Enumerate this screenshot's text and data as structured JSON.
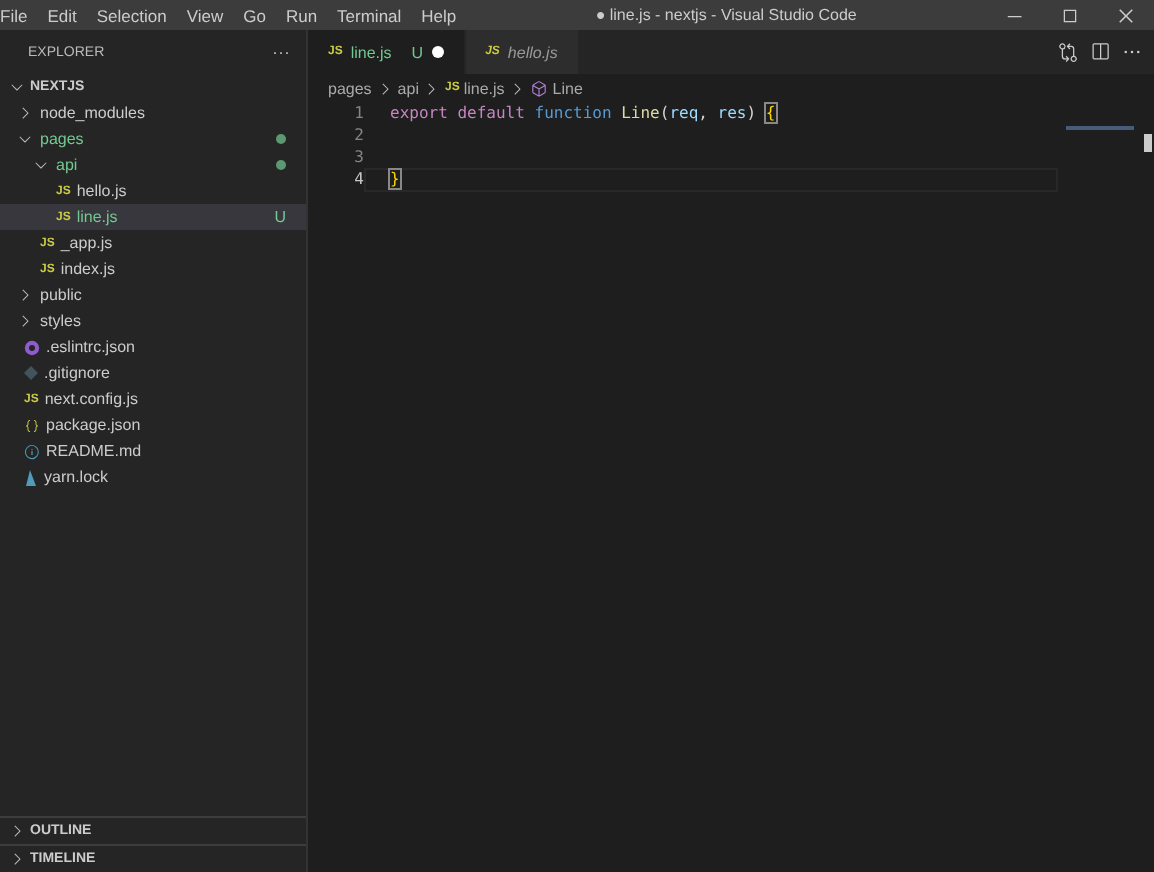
{
  "menu": [
    "File",
    "Edit",
    "Selection",
    "View",
    "Go",
    "Run",
    "Terminal",
    "Help"
  ],
  "window": {
    "title": "● line.js - nextjs - Visual Studio Code"
  },
  "explorer": {
    "title": "EXPLORER",
    "more": "···",
    "root": {
      "label": "NEXTJS",
      "expanded": true
    },
    "tree": [
      {
        "label": "node_modules",
        "kind": "folder",
        "expanded": false,
        "untracked": false,
        "selected": false
      },
      {
        "label": "pages",
        "kind": "folder",
        "expanded": true,
        "untracked": true,
        "dot": true,
        "selected": false,
        "children": [
          {
            "label": "api",
            "kind": "folder",
            "expanded": true,
            "untracked": true,
            "dot": true,
            "selected": false,
            "children": [
              {
                "label": "hello.js",
                "kind": "js",
                "icon_text": "JS",
                "untracked": false,
                "selected": false
              },
              {
                "label": "line.js",
                "kind": "js",
                "icon_text": "JS",
                "untracked": true,
                "badge": "U",
                "selected": true
              }
            ]
          },
          {
            "label": "_app.js",
            "kind": "js",
            "icon_text": "JS",
            "untracked": false,
            "selected": false
          },
          {
            "label": "index.js",
            "kind": "js",
            "icon_text": "JS",
            "untracked": false,
            "selected": false
          }
        ]
      },
      {
        "label": "public",
        "kind": "folder",
        "expanded": false,
        "untracked": false,
        "selected": false
      },
      {
        "label": "styles",
        "kind": "folder",
        "expanded": false,
        "untracked": false,
        "selected": false
      },
      {
        "label": ".eslintrc.json",
        "kind": "eslint",
        "untracked": false,
        "selected": false
      },
      {
        "label": ".gitignore",
        "kind": "git",
        "untracked": false,
        "selected": false
      },
      {
        "label": "next.config.js",
        "kind": "js",
        "icon_text": "JS",
        "untracked": false,
        "selected": false
      },
      {
        "label": "package.json",
        "kind": "json",
        "untracked": false,
        "selected": false
      },
      {
        "label": "README.md",
        "kind": "info",
        "untracked": false,
        "selected": false
      },
      {
        "label": "yarn.lock",
        "kind": "yarn",
        "untracked": false,
        "selected": false
      }
    ]
  },
  "panels": [
    {
      "label": "OUTLINE",
      "expanded": false
    },
    {
      "label": "TIMELINE",
      "expanded": false
    }
  ],
  "tabs": [
    {
      "label": "line.js",
      "icon_text": "JS",
      "badge": "U",
      "modified": true,
      "preview": false,
      "selected": true
    },
    {
      "label": "hello.js",
      "icon_text": "JS",
      "modified": false,
      "preview": true,
      "selected": false
    }
  ],
  "breadcrumbs": [
    {
      "label": "pages"
    },
    {
      "label": "api"
    },
    {
      "label": "line.js",
      "icon_text": "JS"
    },
    {
      "label": "Line",
      "kind": "function"
    }
  ],
  "code": [
    {
      "number": "1",
      "current": false,
      "tokens": [
        {
          "text": "export ",
          "kind": "keyword"
        },
        {
          "text": "default ",
          "kind": "keyword"
        },
        {
          "text": "function ",
          "kind": "storage"
        },
        {
          "text": "Line",
          "kind": "function"
        },
        {
          "text": "(",
          "kind": "punct"
        },
        {
          "text": "req",
          "kind": "param"
        },
        {
          "text": ", ",
          "kind": "punct"
        },
        {
          "text": "res",
          "kind": "param"
        },
        {
          "text": ") ",
          "kind": "punct"
        },
        {
          "text": "{",
          "kind": "bracket"
        }
      ]
    },
    {
      "number": "2",
      "current": false
    },
    {
      "number": "3",
      "current": false
    },
    {
      "number": "4",
      "current": true,
      "tokens": [
        {
          "text": "}",
          "kind": "bracket"
        }
      ]
    }
  ]
}
